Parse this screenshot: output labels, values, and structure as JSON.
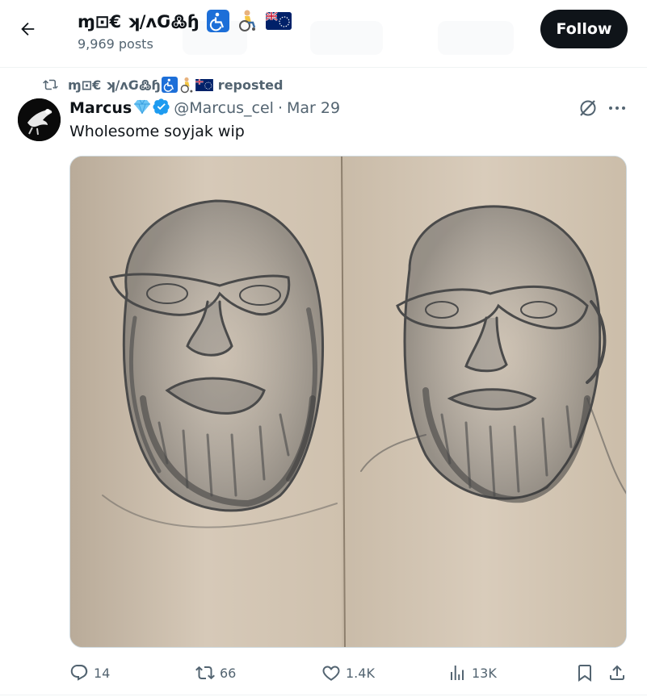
{
  "header": {
    "profile_name": "ɱ⊡€ ʞ/ʌԌ߷ɧ",
    "profile_emoji": "♿👩‍🦽",
    "post_count": "9,969 posts",
    "follow_label": "Follow"
  },
  "repost": {
    "reposter_name": "ɱ⊡€ ʞ/ʌԌ߷ɧ",
    "reposter_emoji": "♿👩‍🦽",
    "suffix": "reposted"
  },
  "tweet": {
    "author_name": "Marcus",
    "gem_emoji": "💎",
    "handle": "@Marcus_cel",
    "separator": "·",
    "date": "Mar 29",
    "text": "Wholesome soyjak wip"
  },
  "actions": {
    "replies": "14",
    "reposts": "66",
    "likes": "1.4K",
    "views": "13K"
  },
  "icons": [
    "back-arrow-icon",
    "accessible-icon",
    "wheelchair-user-icon",
    "cook-islands-flag-icon",
    "repost-icon",
    "verified-badge-icon",
    "grok-icon",
    "more-icon",
    "reply-icon",
    "like-icon",
    "views-icon",
    "bookmark-icon",
    "share-icon"
  ],
  "colors": {
    "text": "#0f1419",
    "secondary": "#536471",
    "verified": "#1d9bf0",
    "follow_bg": "#0f1419",
    "border": "#eff3f4"
  }
}
